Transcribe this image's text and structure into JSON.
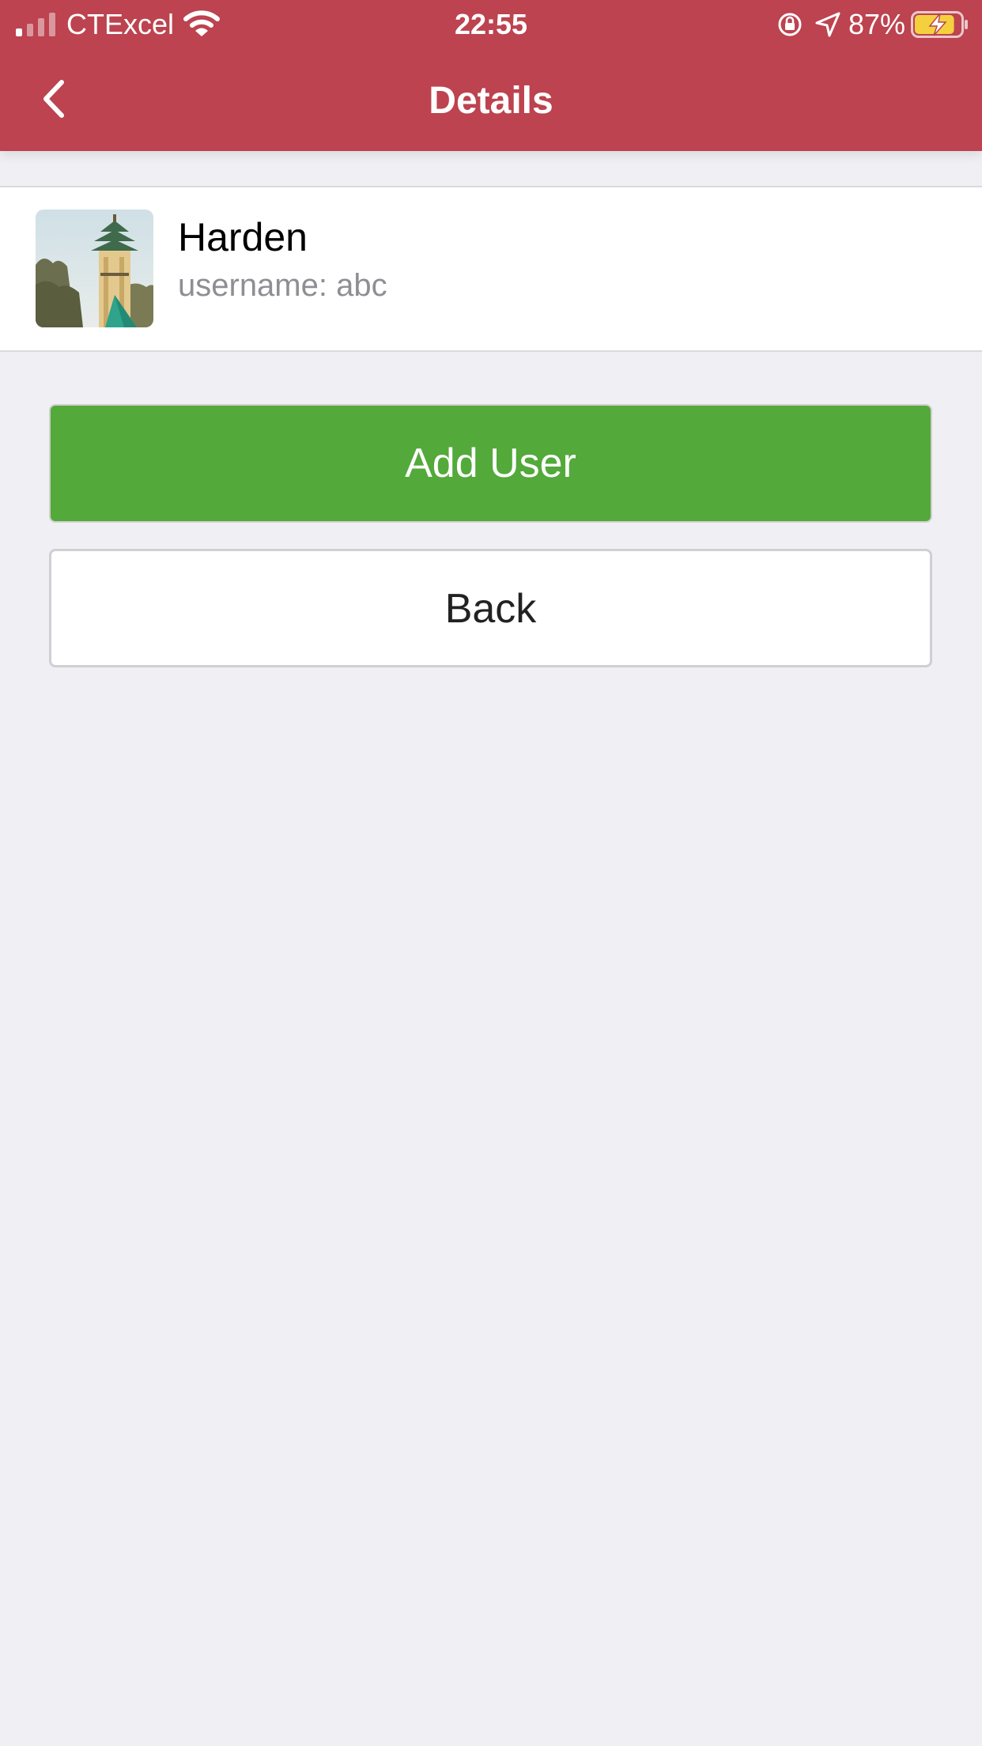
{
  "status_bar": {
    "carrier": "CTExcel",
    "time": "22:55",
    "battery_percent": "87%",
    "battery_level": 0.87,
    "icons": [
      "signal-icon",
      "wifi-icon",
      "rotation-lock-icon",
      "location-icon",
      "battery-charging-icon"
    ]
  },
  "nav": {
    "title": "Details",
    "back_icon": "chevron-left-icon"
  },
  "user": {
    "name": "Harden",
    "username_line": "username: abc",
    "avatar": "pagoda-photo"
  },
  "actions": {
    "add_user_label": "Add User",
    "back_label": "Back"
  },
  "colors": {
    "header": "#bc434f",
    "primary_button": "#53a93a",
    "background": "#efeff4",
    "battery": "#f4d03f"
  }
}
